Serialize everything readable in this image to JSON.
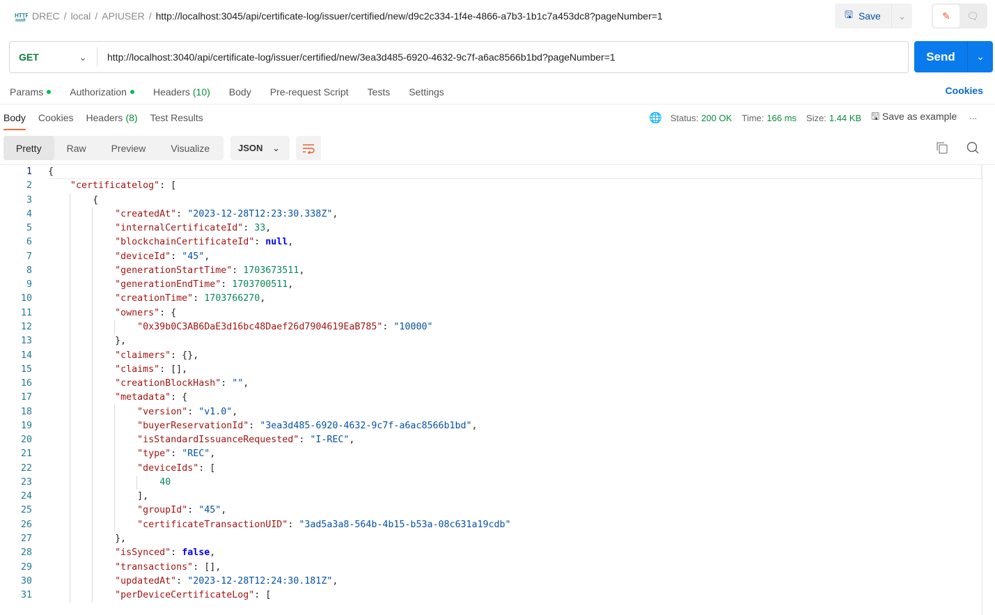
{
  "breadcrumb": {
    "icon": "http-icon",
    "items": [
      "DREC",
      "local",
      "APIUSER"
    ],
    "current": "http://localhost:3045/api/certificate-log/issuer/certified/new/d9c2c334-1f4e-4866-a7b3-1b1c7a453dc8?pageNumber=1"
  },
  "header": {
    "save_label": "Save"
  },
  "request": {
    "method": "GET",
    "url": "http://localhost:3040/api/certificate-log/issuer/certified/new/3ea3d485-6920-4632-9c7f-a6ac8566b1bd?pageNumber=1",
    "send_label": "Send"
  },
  "request_tabs": [
    {
      "label": "Params",
      "dot": true
    },
    {
      "label": "Authorization",
      "dot": true
    },
    {
      "label": "Headers",
      "count": "(10)"
    },
    {
      "label": "Body"
    },
    {
      "label": "Pre-request Script"
    },
    {
      "label": "Tests"
    },
    {
      "label": "Settings"
    }
  ],
  "cookies_link": "Cookies",
  "response_tabs": [
    {
      "label": "Body",
      "active": true
    },
    {
      "label": "Cookies"
    },
    {
      "label": "Headers",
      "count": "(8)"
    },
    {
      "label": "Test Results"
    }
  ],
  "response_status": {
    "status_label": "Status:",
    "status": "200 OK",
    "time_label": "Time:",
    "time": "166 ms",
    "size_label": "Size:",
    "size": "1.44 KB",
    "save_example": "Save as example"
  },
  "view_modes": [
    "Pretty",
    "Raw",
    "Preview",
    "Visualize"
  ],
  "selected_view": "Pretty",
  "format": "JSON",
  "colors": {
    "accent": "#097bed",
    "key": "#a31515",
    "string": "#0451a5",
    "number": "#098658",
    "keyword": "#0000ff",
    "active_tab": "#f26b3a"
  },
  "code_lines": [
    {
      "i": 0,
      "t": [
        [
          "p",
          "{"
        ]
      ]
    },
    {
      "i": 1,
      "t": [
        [
          "k",
          "\"certificatelog\""
        ],
        [
          "p",
          ": ["
        ]
      ]
    },
    {
      "i": 2,
      "t": [
        [
          "p",
          "{"
        ]
      ]
    },
    {
      "i": 3,
      "t": [
        [
          "k",
          "\"createdAt\""
        ],
        [
          "p",
          ": "
        ],
        [
          "s",
          "\"2023-12-28T12:23:30.338Z\""
        ],
        [
          "p",
          ","
        ]
      ]
    },
    {
      "i": 3,
      "t": [
        [
          "k",
          "\"internalCertificateId\""
        ],
        [
          "p",
          ": "
        ],
        [
          "n",
          "33"
        ],
        [
          "p",
          ","
        ]
      ]
    },
    {
      "i": 3,
      "t": [
        [
          "k",
          "\"blockchainCertificateId\""
        ],
        [
          "p",
          ": "
        ],
        [
          "b",
          "null"
        ],
        [
          "p",
          ","
        ]
      ]
    },
    {
      "i": 3,
      "t": [
        [
          "k",
          "\"deviceId\""
        ],
        [
          "p",
          ": "
        ],
        [
          "s",
          "\"45\""
        ],
        [
          "p",
          ","
        ]
      ]
    },
    {
      "i": 3,
      "t": [
        [
          "k",
          "\"generationStartTime\""
        ],
        [
          "p",
          ": "
        ],
        [
          "n",
          "1703673511"
        ],
        [
          "p",
          ","
        ]
      ]
    },
    {
      "i": 3,
      "t": [
        [
          "k",
          "\"generationEndTime\""
        ],
        [
          "p",
          ": "
        ],
        [
          "n",
          "1703700511"
        ],
        [
          "p",
          ","
        ]
      ]
    },
    {
      "i": 3,
      "t": [
        [
          "k",
          "\"creationTime\""
        ],
        [
          "p",
          ": "
        ],
        [
          "n",
          "1703766270"
        ],
        [
          "p",
          ","
        ]
      ]
    },
    {
      "i": 3,
      "t": [
        [
          "k",
          "\"owners\""
        ],
        [
          "p",
          ": {"
        ]
      ]
    },
    {
      "i": 4,
      "t": [
        [
          "k",
          "\"0x39b0C3AB6DaE3d16bc48Daef26d7904619EaB785\""
        ],
        [
          "p",
          ": "
        ],
        [
          "s",
          "\"10000\""
        ]
      ]
    },
    {
      "i": 3,
      "t": [
        [
          "p",
          "},"
        ]
      ]
    },
    {
      "i": 3,
      "t": [
        [
          "k",
          "\"claimers\""
        ],
        [
          "p",
          ": {},"
        ]
      ]
    },
    {
      "i": 3,
      "t": [
        [
          "k",
          "\"claims\""
        ],
        [
          "p",
          ": [],"
        ]
      ]
    },
    {
      "i": 3,
      "t": [
        [
          "k",
          "\"creationBlockHash\""
        ],
        [
          "p",
          ": "
        ],
        [
          "s",
          "\"\""
        ],
        [
          "p",
          ","
        ]
      ]
    },
    {
      "i": 3,
      "t": [
        [
          "k",
          "\"metadata\""
        ],
        [
          "p",
          ": {"
        ]
      ]
    },
    {
      "i": 4,
      "t": [
        [
          "k",
          "\"version\""
        ],
        [
          "p",
          ": "
        ],
        [
          "s",
          "\"v1.0\""
        ],
        [
          "p",
          ","
        ]
      ]
    },
    {
      "i": 4,
      "t": [
        [
          "k",
          "\"buyerReservationId\""
        ],
        [
          "p",
          ": "
        ],
        [
          "s",
          "\"3ea3d485-6920-4632-9c7f-a6ac8566b1bd\""
        ],
        [
          "p",
          ","
        ]
      ]
    },
    {
      "i": 4,
      "t": [
        [
          "k",
          "\"isStandardIssuanceRequested\""
        ],
        [
          "p",
          ": "
        ],
        [
          "s",
          "\"I-REC\""
        ],
        [
          "p",
          ","
        ]
      ]
    },
    {
      "i": 4,
      "t": [
        [
          "k",
          "\"type\""
        ],
        [
          "p",
          ": "
        ],
        [
          "s",
          "\"REC\""
        ],
        [
          "p",
          ","
        ]
      ]
    },
    {
      "i": 4,
      "t": [
        [
          "k",
          "\"deviceIds\""
        ],
        [
          "p",
          ": ["
        ]
      ]
    },
    {
      "i": 5,
      "t": [
        [
          "n",
          "40"
        ]
      ]
    },
    {
      "i": 4,
      "t": [
        [
          "p",
          "],"
        ]
      ]
    },
    {
      "i": 4,
      "t": [
        [
          "k",
          "\"groupId\""
        ],
        [
          "p",
          ": "
        ],
        [
          "s",
          "\"45\""
        ],
        [
          "p",
          ","
        ]
      ]
    },
    {
      "i": 4,
      "t": [
        [
          "k",
          "\"certificateTransactionUID\""
        ],
        [
          "p",
          ": "
        ],
        [
          "s",
          "\"3ad5a3a8-564b-4b15-b53a-08c631a19cdb\""
        ]
      ]
    },
    {
      "i": 3,
      "t": [
        [
          "p",
          "},"
        ]
      ]
    },
    {
      "i": 3,
      "t": [
        [
          "k",
          "\"isSynced\""
        ],
        [
          "p",
          ": "
        ],
        [
          "b",
          "false"
        ],
        [
          "p",
          ","
        ]
      ]
    },
    {
      "i": 3,
      "t": [
        [
          "k",
          "\"transactions\""
        ],
        [
          "p",
          ": [],"
        ]
      ]
    },
    {
      "i": 3,
      "t": [
        [
          "k",
          "\"updatedAt\""
        ],
        [
          "p",
          ": "
        ],
        [
          "s",
          "\"2023-12-28T12:24:30.181Z\""
        ],
        [
          "p",
          ","
        ]
      ]
    },
    {
      "i": 3,
      "t": [
        [
          "k",
          "\"perDeviceCertificateLog\""
        ],
        [
          "p",
          ": ["
        ]
      ]
    }
  ]
}
